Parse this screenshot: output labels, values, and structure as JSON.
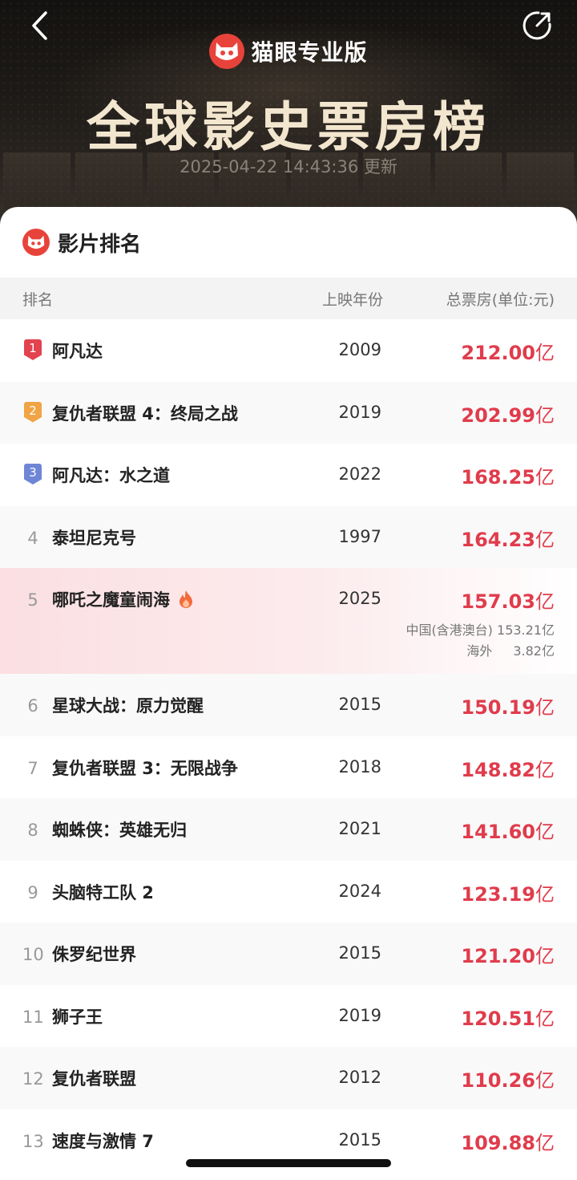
{
  "header": {
    "brand": "猫眼专业版",
    "title": "全球影史票房榜",
    "updated": "2025-04-22 14:43:36 更新"
  },
  "section": {
    "title": "影片排名"
  },
  "columns": {
    "rank": "排名",
    "year": "上映年份",
    "box": "总票房(单位:元)"
  },
  "rows": [
    {
      "rank": "1",
      "title": "阿凡达",
      "year": "2009",
      "box": "212.00",
      "unit": "亿"
    },
    {
      "rank": "2",
      "title": "复仇者联盟 4：终局之战",
      "year": "2019",
      "box": "202.99",
      "unit": "亿"
    },
    {
      "rank": "3",
      "title": "阿凡达：水之道",
      "year": "2022",
      "box": "168.25",
      "unit": "亿"
    },
    {
      "rank": "4",
      "title": "泰坦尼克号",
      "year": "1997",
      "box": "164.23",
      "unit": "亿"
    },
    {
      "rank": "5",
      "title": "哪吒之魔童闹海",
      "year": "2025",
      "box": "157.03",
      "unit": "亿",
      "sub1": "中国(含港澳台) 153.21亿",
      "sub2_label": "海外",
      "sub2_value": "3.82亿"
    },
    {
      "rank": "6",
      "title": "星球大战：原力觉醒",
      "year": "2015",
      "box": "150.19",
      "unit": "亿"
    },
    {
      "rank": "7",
      "title": "复仇者联盟 3：无限战争",
      "year": "2018",
      "box": "148.82",
      "unit": "亿"
    },
    {
      "rank": "8",
      "title": "蜘蛛侠：英雄无归",
      "year": "2021",
      "box": "141.60",
      "unit": "亿"
    },
    {
      "rank": "9",
      "title": "头脑特工队 2",
      "year": "2024",
      "box": "123.19",
      "unit": "亿"
    },
    {
      "rank": "10",
      "title": "侏罗纪世界",
      "year": "2015",
      "box": "121.20",
      "unit": "亿"
    },
    {
      "rank": "11",
      "title": "狮子王",
      "year": "2019",
      "box": "120.51",
      "unit": "亿"
    },
    {
      "rank": "12",
      "title": "复仇者联盟",
      "year": "2012",
      "box": "110.26",
      "unit": "亿"
    },
    {
      "rank": "13",
      "title": "速度与激情 7",
      "year": "2015",
      "box": "109.88",
      "unit": "亿"
    }
  ],
  "colors": {
    "accent": "#e03c4c",
    "brand_red": "#e8433b",
    "rank1": "#e2434f",
    "rank2": "#f0a444",
    "rank3": "#6f86d6"
  },
  "icons": {
    "back": "chevron-left-icon",
    "share": "share-icon",
    "brand": "maoyan-cat-logo",
    "hot": "fire-icon"
  }
}
